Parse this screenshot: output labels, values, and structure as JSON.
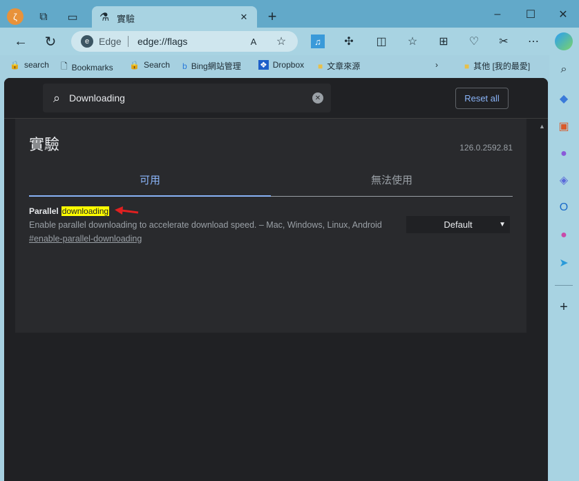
{
  "tab": {
    "title": "實驗"
  },
  "address": {
    "site_label": "Edge",
    "url": "edge://flags"
  },
  "bookmarks": [
    {
      "label": "search"
    },
    {
      "label": "Bookmarks"
    },
    {
      "label": "Search"
    },
    {
      "label": "Bing網站管理"
    },
    {
      "label": "Dropbox"
    },
    {
      "label": "文章來源"
    }
  ],
  "other_bookmarks": "其他 [我的最愛]",
  "flags": {
    "search_value": "Downloading",
    "reset_label": "Reset all",
    "title": "實驗",
    "version": "126.0.2592.81",
    "tabs": [
      {
        "label": "可用"
      },
      {
        "label": "無法使用"
      }
    ],
    "experiment": {
      "name_prefix": "Parallel",
      "name_highlight": "downloading",
      "description": "Enable parallel downloading to accelerate download speed. – Mac, Windows, Linux, Android",
      "link": "#enable-parallel-downloading",
      "selected": "Default"
    }
  },
  "colors": {
    "accent": "#8ab4f8",
    "highlight": "#ffff00",
    "arrow": "#e02020"
  }
}
